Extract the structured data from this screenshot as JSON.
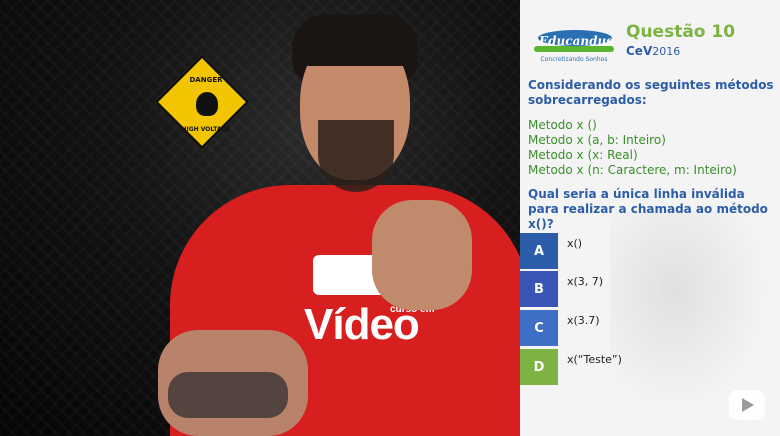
{
  "header": {
    "brand_name": "Educandus",
    "brand_tagline": "Concretizando Sonhos",
    "question_title": "Questão 10",
    "exam_label": "CeV",
    "exam_year": "2016"
  },
  "question": {
    "intro": "Considerando os seguintes métodos sobrecarregados:",
    "methods": [
      "Metodo x ()",
      "Metodo x (a, b: Inteiro)",
      "Metodo x (x: Real)",
      "Metodo x (n: Caractere, m: Inteiro)"
    ],
    "prompt": "Qual seria a única linha inválida para realizar a chamada ao método x()?"
  },
  "options": [
    {
      "letter": "A",
      "text": "x()",
      "color": "#2c5da8"
    },
    {
      "letter": "B",
      "text": "x(3, 7)",
      "color": "#3b55b7"
    },
    {
      "letter": "C",
      "text": "x(3.7)",
      "color": "#3f6fc4"
    },
    {
      "letter": "D",
      "text": "x(“Teste”)",
      "color": "#7cb342"
    }
  ],
  "video": {
    "sign_top": "DANGER",
    "sign_bottom": "HIGH VOLTAGE",
    "shirt_logo": "Vídeo",
    "shirt_logo_small": "curso em"
  },
  "icons": {
    "watermark": "youtube-play-icon"
  }
}
